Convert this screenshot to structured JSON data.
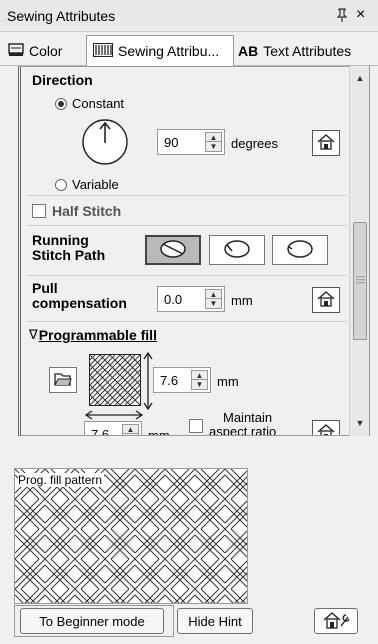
{
  "window": {
    "title": "Sewing Attributes",
    "pin_glyph": "ᴨ",
    "close_glyph": "×"
  },
  "tabs": [
    {
      "label": "Color",
      "icon": "color-icon"
    },
    {
      "label": "Sewing Attribu...",
      "icon": "sewing-icon",
      "active": true
    },
    {
      "label": "Text Attributes",
      "icon_text": "AB"
    }
  ],
  "direction": {
    "heading": "Direction",
    "constant_label": "Constant",
    "variable_label": "Variable",
    "selected": "Constant",
    "value": "90",
    "unit": "degrees"
  },
  "half_stitch": {
    "label": "Half Stitch",
    "checked": false
  },
  "running_stitch_path": {
    "label_line1": "Running",
    "label_line2": "Stitch Path",
    "options": [
      "path-option-1",
      "path-option-2",
      "path-option-3"
    ],
    "selected_index": 0
  },
  "pull_compensation": {
    "label_line1": "Pull",
    "label_line2": "compensation",
    "value": "0.0",
    "unit": "mm"
  },
  "programmable_fill": {
    "heading": "Programmable fill",
    "collapse_glyph": "∇",
    "height_value": "7.6",
    "height_unit": "mm",
    "width_value": "7.6",
    "width_unit": "mm",
    "maintain_label_line1": "Maintain",
    "maintain_label_line2": "aspect ratio",
    "maintain_checked": false
  },
  "hint": {
    "label": "Prog. fill pattern"
  },
  "buttons": {
    "beginner_mode": "To Beginner mode",
    "hide_hint": "Hide Hint"
  }
}
